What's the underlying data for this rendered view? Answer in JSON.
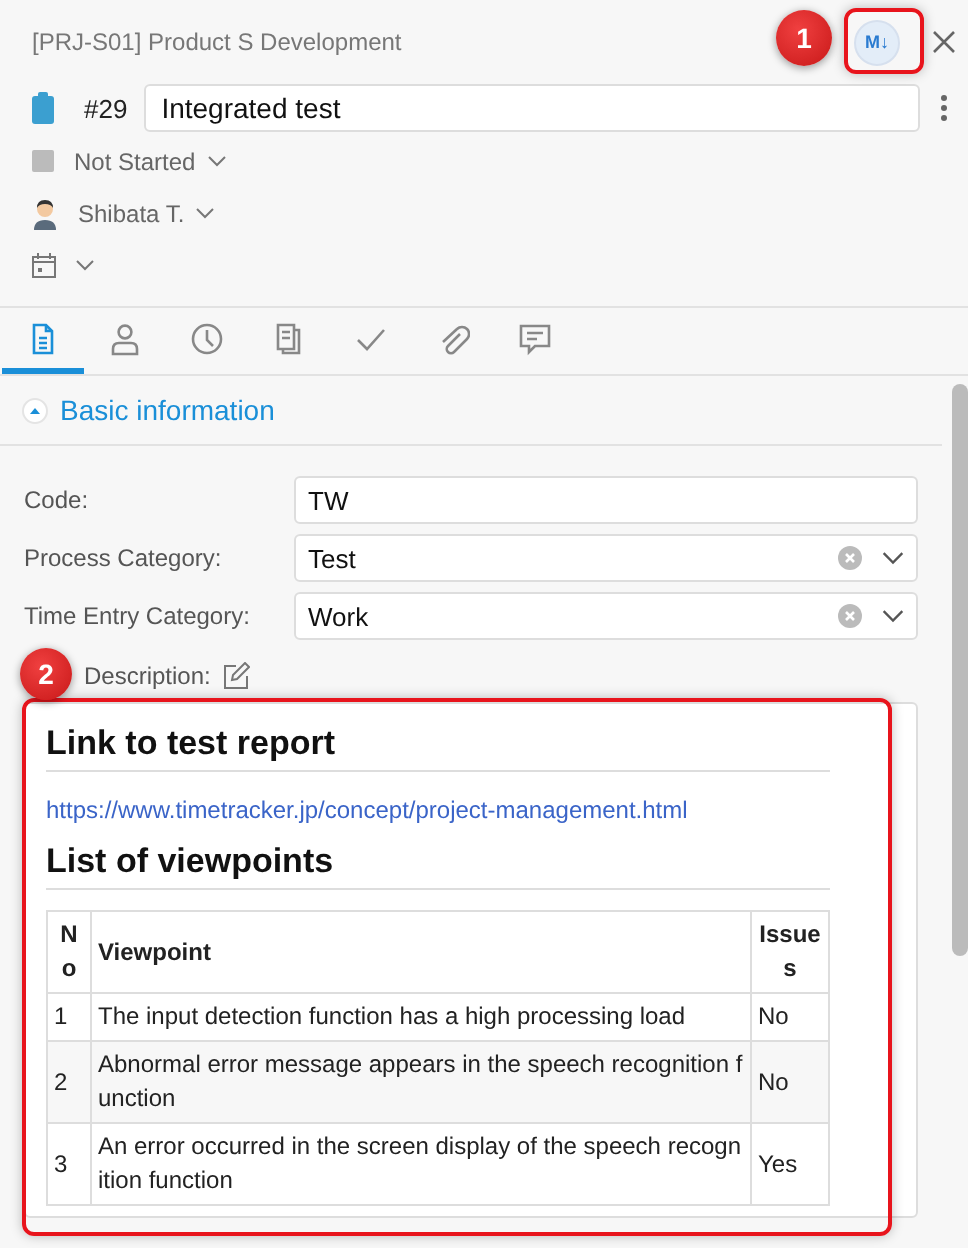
{
  "header": {
    "project": "[PRJ-S01] Product S Development",
    "markdown_button": "M↓"
  },
  "task": {
    "number": "#29",
    "title": "Integrated test"
  },
  "status": {
    "label": "Not Started"
  },
  "assignee": {
    "name": "Shibata T."
  },
  "tabs": [
    {
      "kind": "document",
      "selected": true
    },
    {
      "kind": "person",
      "selected": false
    },
    {
      "kind": "clock",
      "selected": false
    },
    {
      "kind": "pages",
      "selected": false
    },
    {
      "kind": "check",
      "selected": false
    },
    {
      "kind": "clip",
      "selected": false
    },
    {
      "kind": "comment",
      "selected": false
    }
  ],
  "section": {
    "title": "Basic information",
    "expanded": true
  },
  "fields": [
    {
      "kind": "text",
      "label": "Code:",
      "value": "TW"
    },
    {
      "kind": "select",
      "label": "Process Category:",
      "value": "Test"
    },
    {
      "kind": "select",
      "label": "Time Entry Category:",
      "value": "Work"
    }
  ],
  "description": {
    "label": "Description:",
    "heading_1": "Link to test report",
    "link": "https://www.timetracker.jp/concept/project-management.html",
    "heading_2": "List of viewpoints",
    "table": {
      "columns": [
        "No",
        "Viewpoint",
        "Issues"
      ],
      "rows": [
        [
          "1",
          "The input detection function has a high processing load",
          "No"
        ],
        [
          "2",
          "Abnormal error message appears in the speech recognition function",
          "No"
        ],
        [
          "3",
          "An error occurred in the screen display of the speech recognition function",
          "Yes"
        ]
      ]
    }
  },
  "callouts": [
    {
      "label": "1"
    },
    {
      "label": "2"
    }
  ]
}
